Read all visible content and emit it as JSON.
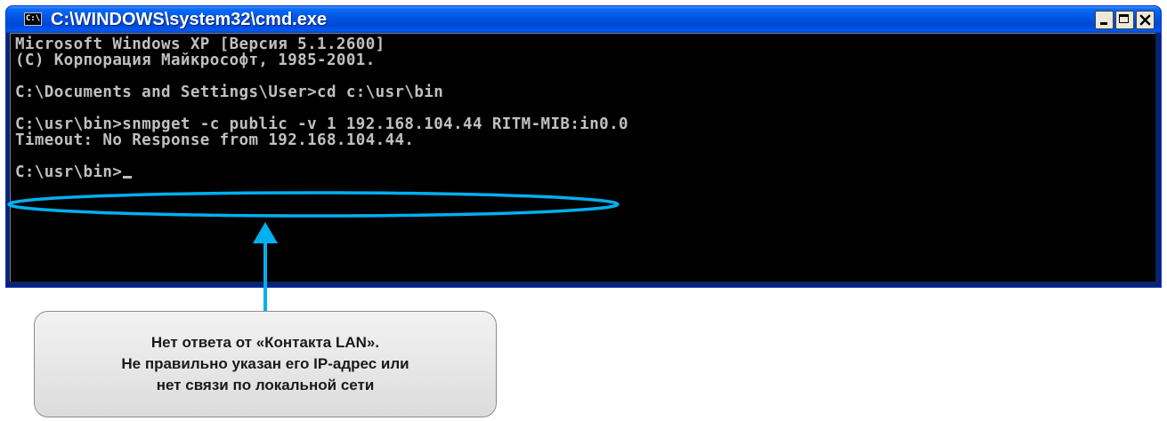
{
  "window": {
    "title": "C:\\WINDOWS\\system32\\cmd.exe",
    "sysicon_label": "C:\\",
    "controls": [
      "minimize",
      "maximize",
      "close"
    ]
  },
  "console": {
    "lines": [
      "Microsoft Windows XP [Версия 5.1.2600]",
      "(С) Корпорация Майкрософт, 1985-2001.",
      "C:\\Documents and Settings\\User>cd c:\\usr\\bin",
      "C:\\usr\\bin>snmpget -c public -v 1 192.168.104.44 RITM-MIB:in0.0",
      "Timeout: No Response from 192.168.104.44.",
      "C:\\usr\\bin>"
    ]
  },
  "annotation": {
    "lines": [
      "Нет ответа от «Контакта LAN».",
      "Не правильно указан его IP-адрес или",
      "нет связи по локальной сети"
    ],
    "highlight_color": "#00b0f0"
  },
  "colors": {
    "titlebar": "#0053e1",
    "console_bg": "#000000",
    "console_text": "#c0c0c0",
    "callout_bg": "#e6e6e6"
  }
}
